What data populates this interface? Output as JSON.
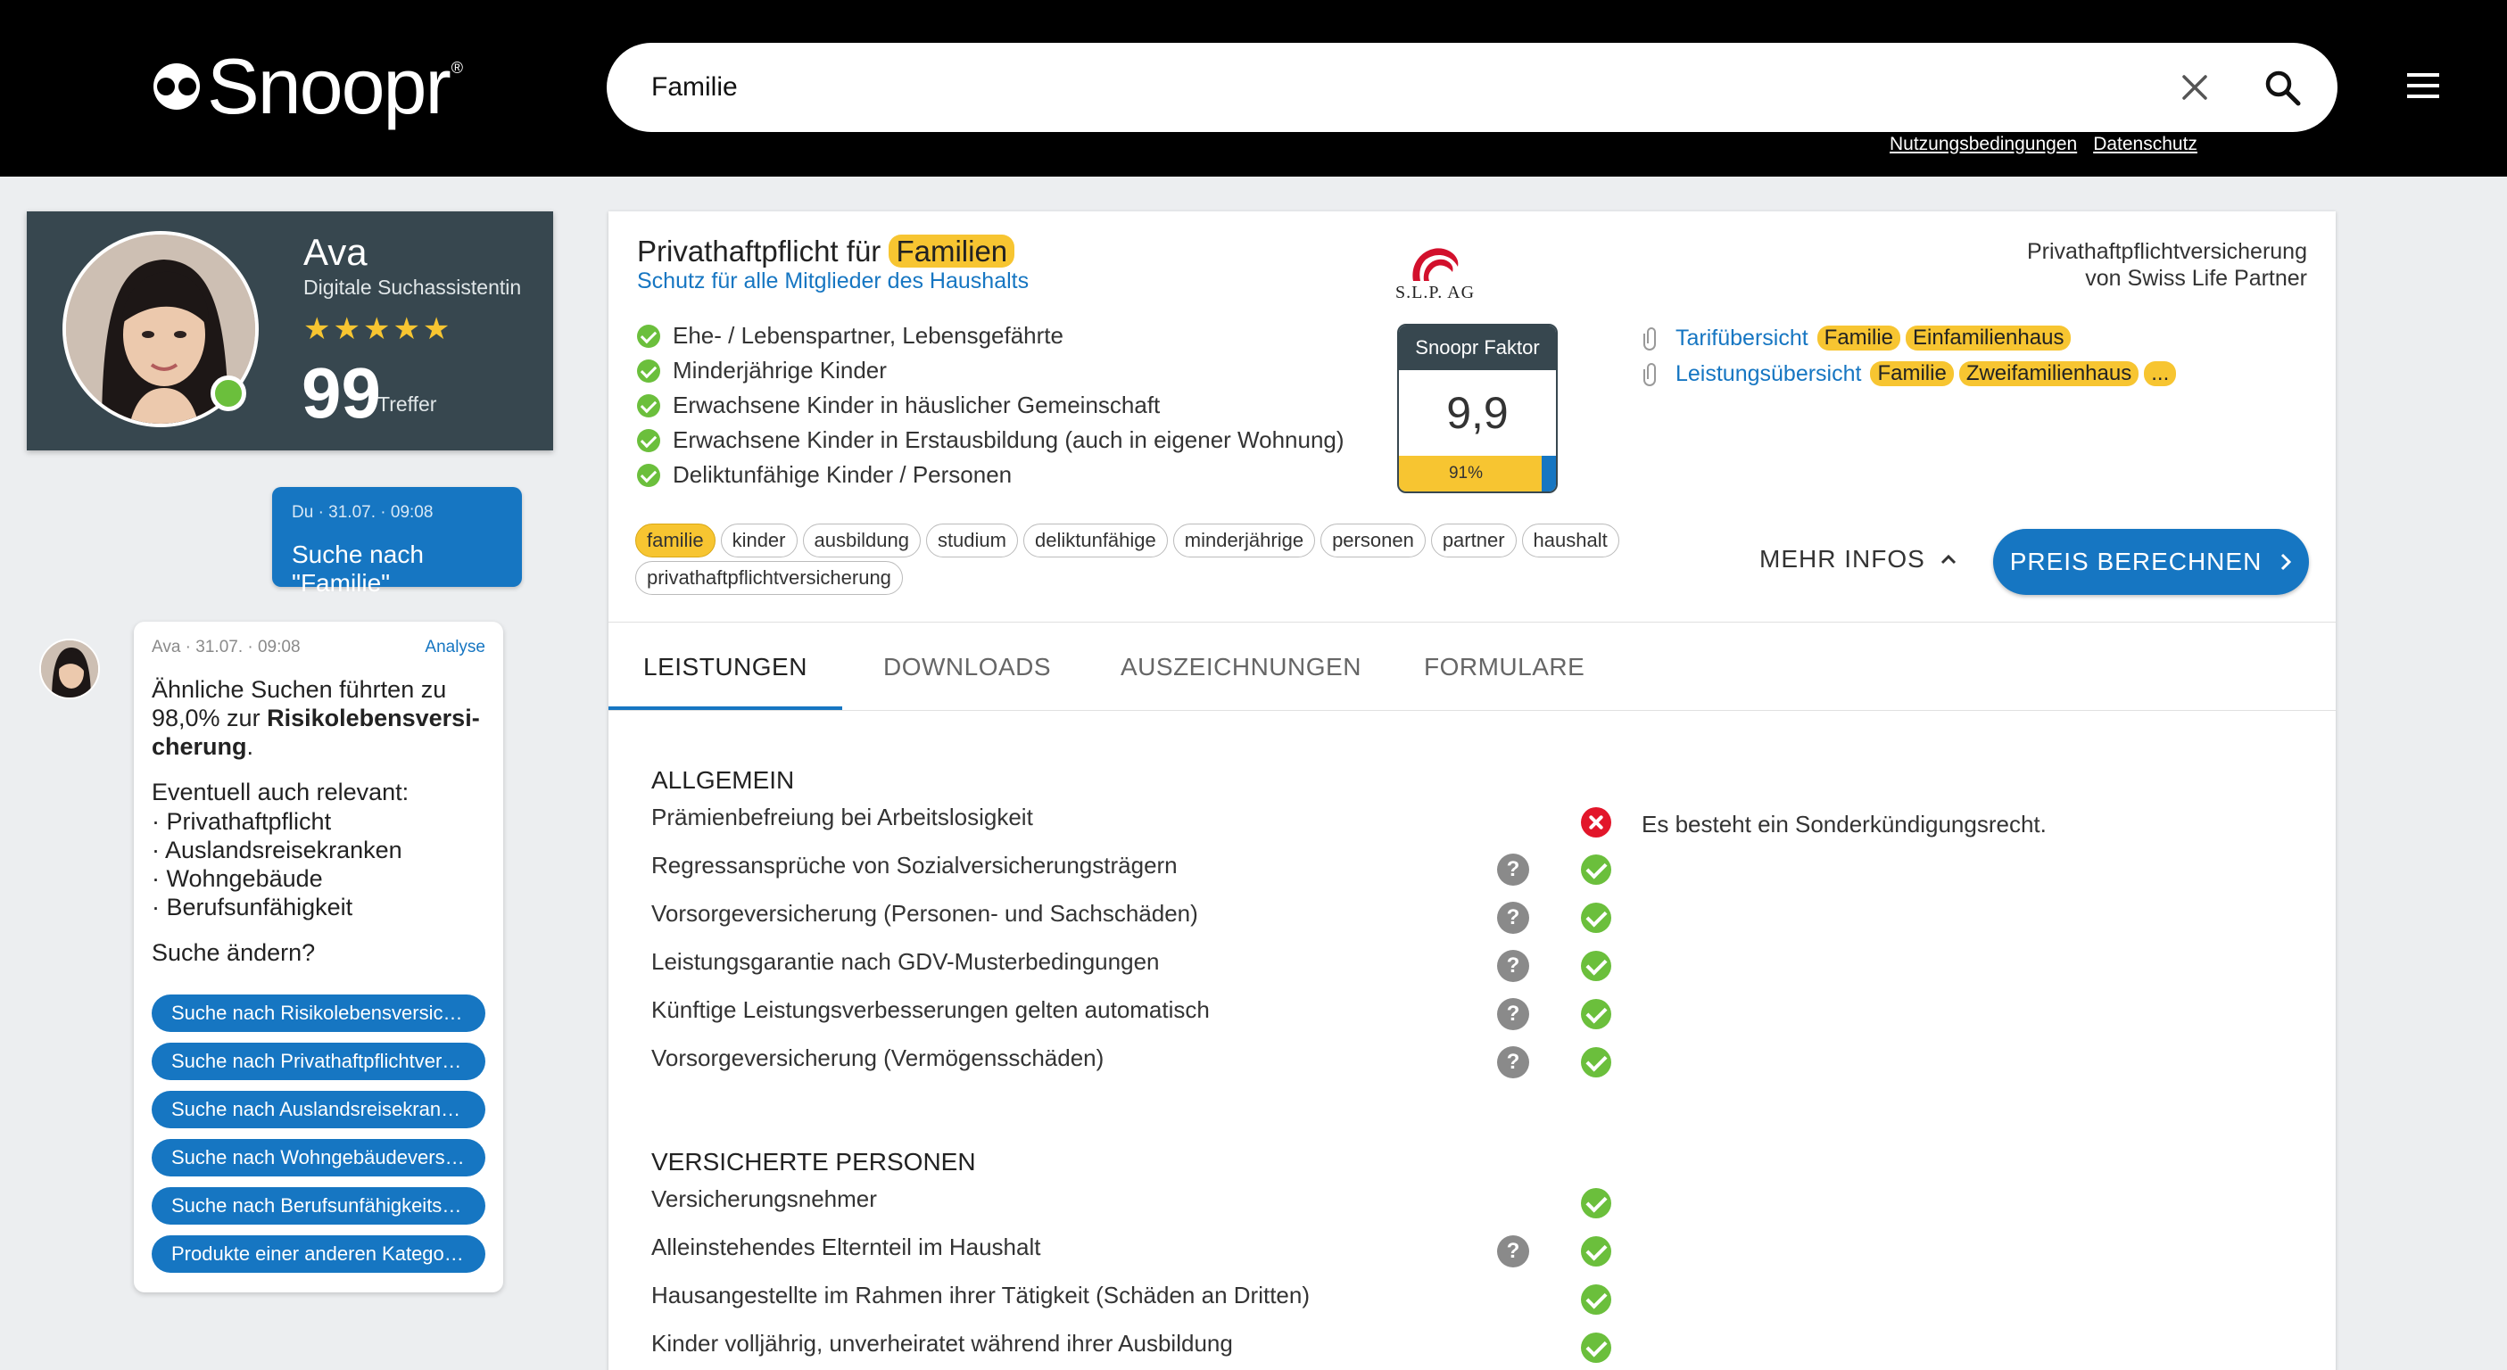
{
  "header": {
    "brand": "Snoopr",
    "brand_mark": "®",
    "search_value": "Familie",
    "links": [
      "Nutzungsbedingungen",
      "Datenschutz"
    ]
  },
  "assistant": {
    "name": "Ava",
    "role": "Digitale Suchassistentin",
    "rating_stars": "★★★★★",
    "hit_count": "99",
    "hit_label": "Treffer"
  },
  "chat": {
    "user_meta": "Du · 31.07. · 09:08",
    "user_text": "Suche nach \"Familie\"",
    "ava_meta": "Ava · 31.07. · 09:08",
    "ava_analyse": "Analyse",
    "ava_msg_pre": "Ähnliche Suchen führten zu 98,0% zur ",
    "ava_msg_bold": "Risikolebensversi-cherung",
    "ava_msg_post": ".",
    "related_title": "Eventuell auch relevant:",
    "related": [
      "· Privathaftpflicht",
      "· Auslandsreisekranken",
      "· Wohngebäude",
      "· Berufsunfähigkeit"
    ],
    "change_prompt": "Suche ändern?",
    "suggestions": [
      "Suche nach Risikolebensversich...",
      "Suche nach Privathaftpflichtvers...",
      "Suche nach Auslandsreisekrank...",
      "Suche nach Wohngebäudeversic...",
      "Suche nach Berufsunfähigkeitsv...",
      "Produkte einer anderen Kategorie"
    ]
  },
  "product": {
    "title_pre": "Privathaftpflicht für ",
    "title_highlight": "Familien",
    "subtitle": "Schutz für alle Mitglieder des Haushalts",
    "insurer_logo_text": "S.L.P. AG",
    "provider_line1": "Privathaftpflichtversicherung",
    "provider_line2": "von Swiss Life Partner",
    "features": [
      "Ehe- / Lebenspartner, Lebensgefährte",
      "Minderjährige Kinder",
      "Erwachsene Kinder in häuslicher Gemeinschaft",
      "Erwachsene Kinder in Erstausbildung (auch in eigener Wohnung)",
      "Deliktunfähige Kinder / Personen"
    ],
    "factor_label": "Snoopr Faktor",
    "factor_value": "9,9",
    "factor_percent_text": "91%",
    "factor_percent": 0.91,
    "docs": [
      {
        "label": "Tarifübersicht",
        "tags": [
          "Familie",
          "Einfamilienhaus"
        ]
      },
      {
        "label": "Leistungsübersicht",
        "tags": [
          "Familie",
          "Zweifamilienhaus",
          "..."
        ]
      }
    ],
    "tags": [
      "familie",
      "kinder",
      "ausbildung",
      "studium",
      "deliktunfähige",
      "minderjährige",
      "personen",
      "partner",
      "haushalt",
      "privathaftpflichtversicherung"
    ],
    "more_info": "MEHR INFOS",
    "calc_button": "PREIS BERECHNEN"
  },
  "tabs": [
    "LEISTUNGEN",
    "DOWNLOADS",
    "AUSZEICHNUNGEN",
    "FORMULARE"
  ],
  "sections": [
    {
      "title": "ALLGEMEIN",
      "rows": [
        {
          "label": "Prämienbefreiung bei Arbeitslosigkeit",
          "status": "no",
          "help": false,
          "note": "Es besteht ein Sonderkündigungsrecht."
        },
        {
          "label": "Regressansprüche von Sozialversicherungsträgern",
          "status": "yes",
          "help": true
        },
        {
          "label": "Vorsorgeversicherung (Personen- und Sachschäden)",
          "status": "yes",
          "help": true
        },
        {
          "label": "Leistungsgarantie nach GDV-Musterbedingungen",
          "status": "yes",
          "help": true
        },
        {
          "label": "Künftige Leistungsverbesserungen gelten automatisch",
          "status": "yes",
          "help": true
        },
        {
          "label": "Vorsorgeversicherung (Vermögensschäden)",
          "status": "yes",
          "help": true
        }
      ]
    },
    {
      "title": "VERSICHERTE PERSONEN",
      "rows": [
        {
          "label": "Versicherungsnehmer",
          "status": "yes",
          "help": false
        },
        {
          "label": "Alleinstehendes Elternteil im Haushalt",
          "status": "yes",
          "help": true
        },
        {
          "label": "Hausangestellte im Rahmen ihrer Tätigkeit (Schäden an Dritten)",
          "status": "yes",
          "help": false
        },
        {
          "label": "Kinder volljährig, unverheiratet während ihrer Ausbildung",
          "status": "yes",
          "help": false
        }
      ]
    }
  ],
  "colors": {
    "accent": "#1676c2",
    "highlight": "#f7c531",
    "ok": "#6bbf3c",
    "no": "#e2162a",
    "assistant_bg": "#37474f"
  }
}
